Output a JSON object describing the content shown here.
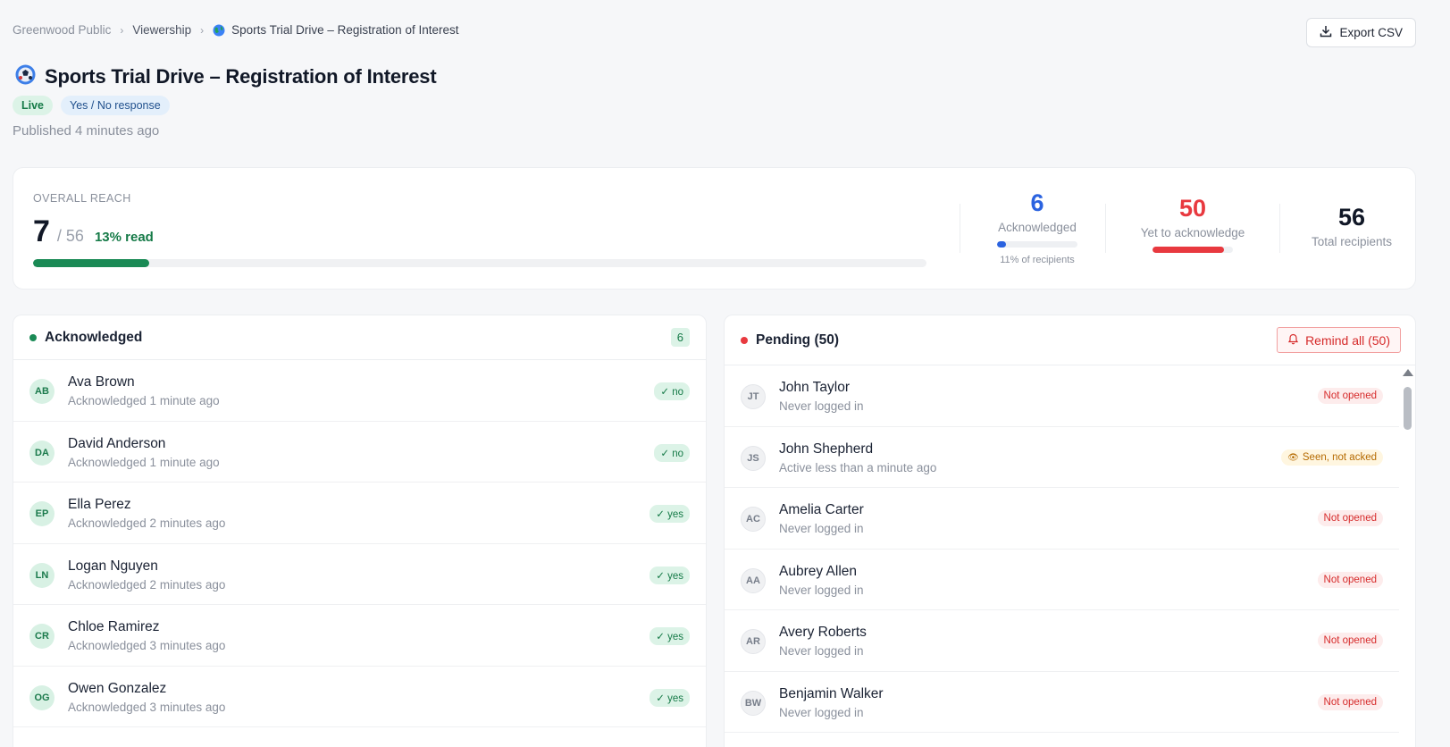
{
  "breadcrumb": {
    "items": [
      "Greenwood Public",
      "Viewership",
      "Sports Trial Drive – Registration of Interest"
    ],
    "separator": "›"
  },
  "header": {
    "export_label": "Export CSV",
    "title": "Sports Trial Drive – Registration of Interest",
    "status_badge": "Live",
    "type_badge": "Yes / No response",
    "published": "Published 4 minutes ago"
  },
  "reach": {
    "label": "OVERALL REACH",
    "read": "7",
    "total": "/ 56",
    "percent": "13% read",
    "fill_fraction": 0.13,
    "acknowledged": {
      "value": "6",
      "label": "Acknowledged",
      "sub": "11% of recipients",
      "fill_fraction": 0.11
    },
    "yet": {
      "value": "50",
      "label": "Yet to acknowledge",
      "fill_fraction": 0.89
    },
    "total_recipients": {
      "value": "56",
      "label": "Total recipients"
    }
  },
  "acknowledged": {
    "title": "Acknowledged",
    "count": "6",
    "rows": [
      {
        "initials": "AB",
        "name": "Ava Brown",
        "sub": "Acknowledged 1 minute ago",
        "badge": "✓ no"
      },
      {
        "initials": "DA",
        "name": "David Anderson",
        "sub": "Acknowledged 1 minute ago",
        "badge": "✓ no"
      },
      {
        "initials": "EP",
        "name": "Ella Perez",
        "sub": "Acknowledged 2 minutes ago",
        "badge": "✓ yes"
      },
      {
        "initials": "LN",
        "name": "Logan Nguyen",
        "sub": "Acknowledged 2 minutes ago",
        "badge": "✓ yes"
      },
      {
        "initials": "CR",
        "name": "Chloe Ramirez",
        "sub": "Acknowledged 3 minutes ago",
        "badge": "✓ yes"
      },
      {
        "initials": "OG",
        "name": "Owen Gonzalez",
        "sub": "Acknowledged 3 minutes ago",
        "badge": "✓ yes"
      }
    ]
  },
  "pending": {
    "title": "Pending (50)",
    "remind_label": "Remind all (50)",
    "rows": [
      {
        "initials": "JT",
        "name": "John Taylor",
        "sub": "Never logged in",
        "badge": "Not opened",
        "kind": "no-open"
      },
      {
        "initials": "JS",
        "name": "John Shepherd",
        "sub": "Active less than a minute ago",
        "badge": "Seen, not acked",
        "kind": "seen"
      },
      {
        "initials": "AC",
        "name": "Amelia Carter",
        "sub": "Never logged in",
        "badge": "Not opened",
        "kind": "no-open"
      },
      {
        "initials": "AA",
        "name": "Aubrey Allen",
        "sub": "Never logged in",
        "badge": "Not opened",
        "kind": "no-open"
      },
      {
        "initials": "AR",
        "name": "Avery Roberts",
        "sub": "Never logged in",
        "badge": "Not opened",
        "kind": "no-open"
      },
      {
        "initials": "BW",
        "name": "Benjamin Walker",
        "sub": "Never logged in",
        "badge": "Not opened",
        "kind": "no-open"
      }
    ]
  },
  "colors": {
    "green": "#1a8a55",
    "blue": "#2b63e0",
    "red": "#e8393f",
    "dark": "#111827"
  }
}
